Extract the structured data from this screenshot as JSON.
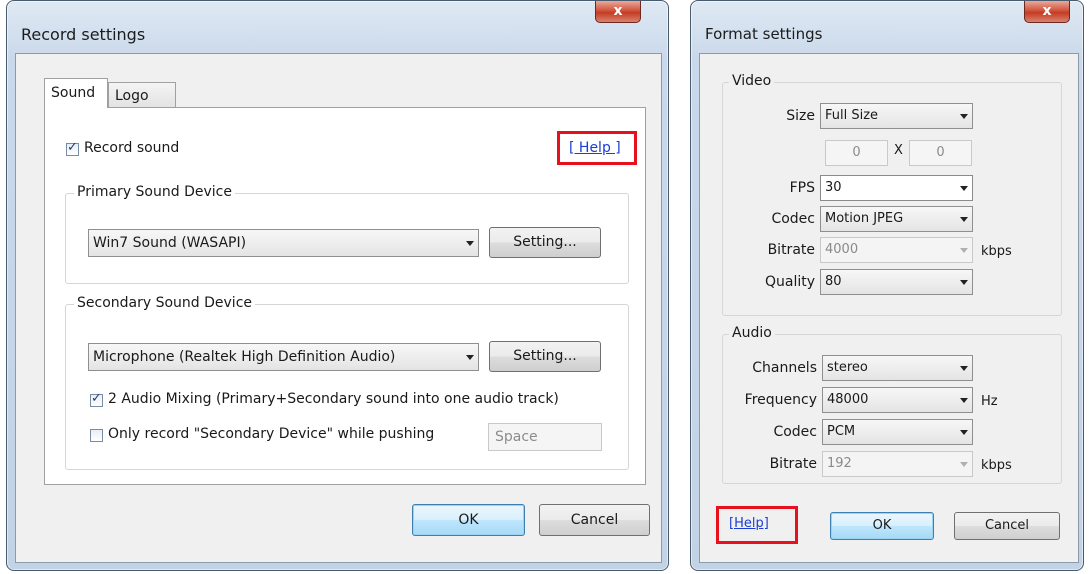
{
  "record": {
    "title": "Record settings",
    "close_glyph": "x",
    "tabs": [
      "Sound",
      "Logo"
    ],
    "record_sound": {
      "label": "Record sound",
      "checked": true
    },
    "help": "[ Help ]",
    "primary": {
      "legend": "Primary Sound Device",
      "device": "Win7 Sound (WASAPI)",
      "setting_button": "Setting..."
    },
    "secondary": {
      "legend": "Secondary Sound Device",
      "device": "Microphone (Realtek High Definition Audio)",
      "setting_button": "Setting...",
      "mixing": {
        "label": "2 Audio Mixing (Primary+Secondary sound into one audio track)",
        "checked": true
      },
      "only_record": {
        "label": "Only record \"Secondary Device\" while pushing",
        "checked": false
      },
      "hotkey": "Space"
    },
    "ok": "OK",
    "cancel": "Cancel"
  },
  "format": {
    "title": "Format settings",
    "close_glyph": "x",
    "video": {
      "legend": "Video",
      "size_label": "Size",
      "size": "Full Size",
      "width": "0",
      "x_sep": "X",
      "height": "0",
      "fps_label": "FPS",
      "fps": "30",
      "codec_label": "Codec",
      "codec": "Motion JPEG",
      "bitrate_label": "Bitrate",
      "bitrate": "4000",
      "bitrate_unit": "kbps",
      "quality_label": "Quality",
      "quality": "80"
    },
    "audio": {
      "legend": "Audio",
      "channels_label": "Channels",
      "channels": "stereo",
      "frequency_label": "Frequency",
      "frequency": "48000",
      "frequency_unit": "Hz",
      "codec_label": "Codec",
      "codec": "PCM",
      "bitrate_label": "Bitrate",
      "bitrate": "192",
      "bitrate_unit": "kbps"
    },
    "help": "[Help]",
    "ok": "OK",
    "cancel": "Cancel"
  },
  "colors": {
    "highlight": "#e8101d",
    "link": "#1a3ed3",
    "frame": "#c3d3e6"
  }
}
